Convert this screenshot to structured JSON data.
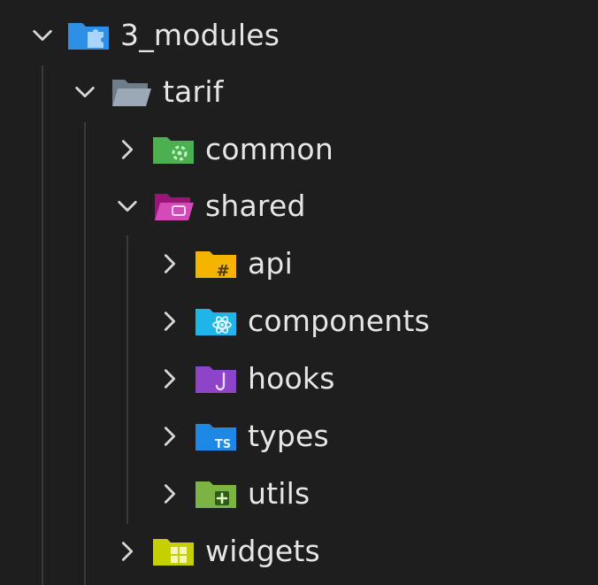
{
  "explorer": {
    "items": [
      {
        "label": "3_modules",
        "expanded": true,
        "icon": "folder-modules-icon",
        "color": "#2d8fe6"
      },
      {
        "label": "tarif",
        "expanded": true,
        "icon": "folder-open-icon",
        "color": "#8a9aa8"
      },
      {
        "label": "common",
        "expanded": false,
        "icon": "folder-common-icon",
        "color": "#4caf50"
      },
      {
        "label": "shared",
        "expanded": true,
        "icon": "folder-shared-icon",
        "color": "#c2188f"
      },
      {
        "label": "api",
        "expanded": false,
        "icon": "folder-api-icon",
        "color": "#f4b400"
      },
      {
        "label": "components",
        "expanded": false,
        "icon": "folder-components-icon",
        "color": "#1fb5e8"
      },
      {
        "label": "hooks",
        "expanded": false,
        "icon": "folder-hooks-icon",
        "color": "#8e44c8"
      },
      {
        "label": "types",
        "expanded": false,
        "icon": "folder-types-icon",
        "color": "#1e88e5"
      },
      {
        "label": "utils",
        "expanded": false,
        "icon": "folder-utils-icon",
        "color": "#7cb342"
      },
      {
        "label": "widgets",
        "expanded": false,
        "icon": "folder-widgets-icon",
        "color": "#c6d000"
      }
    ]
  }
}
